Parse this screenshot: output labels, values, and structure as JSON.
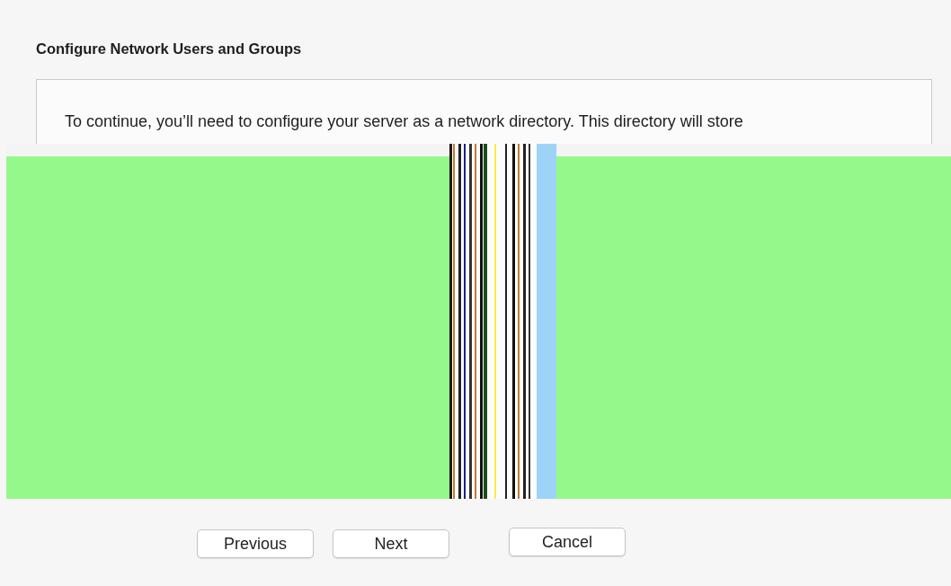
{
  "dialog": {
    "title": "Configure Network Users and Groups",
    "message": "To continue, you’ll need to configure your server as a network directory. This directory will store",
    "navigation_buttons": [
      "Previous",
      "Next"
    ],
    "cancel_button": "Cancel"
  }
}
